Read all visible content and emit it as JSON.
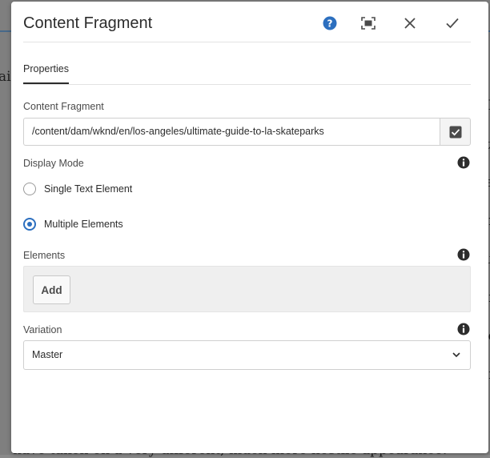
{
  "background": {
    "left_fragment": "ai",
    "right_fragments": [
      "el",
      "it",
      "le",
      "ar",
      "lu",
      "of",
      "cc",
      "of"
    ],
    "bottom_fragment": "nave taken on a very different, much more hostile appearance."
  },
  "dialog": {
    "title": "Content Fragment",
    "tab": "Properties",
    "content_fragment": {
      "label": "Content Fragment",
      "value": "/content/dam/wknd/en/los-angeles/ultimate-guide-to-la-skateparks"
    },
    "display_mode": {
      "label": "Display Mode",
      "options": [
        {
          "label": "Single Text Element",
          "checked": false
        },
        {
          "label": "Multiple Elements",
          "checked": true
        }
      ]
    },
    "elements": {
      "label": "Elements",
      "add_label": "Add"
    },
    "variation": {
      "label": "Variation",
      "value": "Master"
    }
  },
  "colors": {
    "accent": "#2c6fbf",
    "text": "#2c2c2c"
  }
}
